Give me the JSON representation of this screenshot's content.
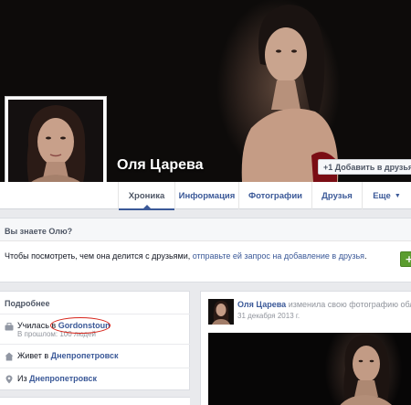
{
  "profile": {
    "name": "Оля Царева",
    "add_friend_label": "+1 Добавить в друзья"
  },
  "tabs": [
    {
      "label": "Хроника",
      "active": true
    },
    {
      "label": "Информация",
      "active": false
    },
    {
      "label": "Фотографии",
      "active": false
    },
    {
      "label": "Друзья",
      "active": false
    },
    {
      "label": "Еще",
      "active": false
    }
  ],
  "know": {
    "title": "Вы знаете Олю?",
    "text_before": "Чтобы посмотреть, чем она делится с друзьями,",
    "link_text": "отправьте ей запрос на добавление в друзья",
    "text_after": "."
  },
  "about": {
    "title": "Подробнее",
    "studied_prefix": "Училась в",
    "school": "Gordonstoun",
    "studied_sub": "В прошлом: 100 людей",
    "lives_prefix": "Живет в",
    "lives_city": "Днепропетровск",
    "from_prefix": "Из",
    "from_city": "Днепропетровск"
  },
  "story": {
    "author": "Оля Царева",
    "action": "изменила свою фотографию обло",
    "date": "31 декабря 2013 г."
  },
  "colors": {
    "link": "#3b5998",
    "annotation_circle": "#d8261c",
    "add_button": "#5b9d2f"
  },
  "icons": [
    "briefcase-icon",
    "home-icon",
    "location-pin-icon",
    "chevron-down-icon",
    "add-friend-icon"
  ]
}
